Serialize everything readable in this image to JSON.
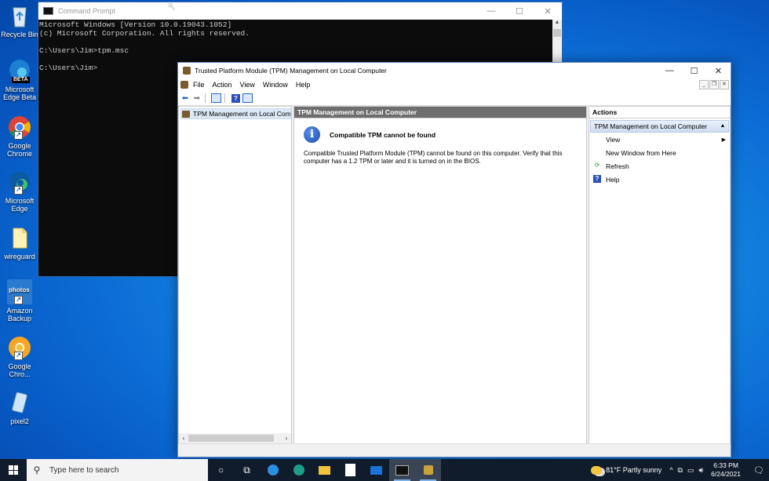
{
  "desktop": {
    "icons": [
      {
        "label": "Recycle Bin",
        "icon": "recycle-bin-icon"
      },
      {
        "label": "Microsoft Edge Beta",
        "badge": "BETA",
        "icon": "edge-beta-icon"
      },
      {
        "label": "Google Chrome",
        "icon": "chrome-icon"
      },
      {
        "label": "Microsoft Edge",
        "icon": "edge-icon"
      },
      {
        "label": "wireguard",
        "icon": "folder-icon"
      },
      {
        "label": "Amazon Backup",
        "badge": "photos",
        "icon": "amazon-photos-icon"
      },
      {
        "label": "Google Chro...",
        "icon": "chrome-canary-icon"
      },
      {
        "label": "pixel2",
        "icon": "pixel2-icon"
      }
    ]
  },
  "cmd": {
    "title": "Command Prompt",
    "lines": [
      "Microsoft Windows [Version 10.0.19043.1052]",
      "(c) Microsoft Corporation. All rights reserved.",
      "",
      "C:\\Users\\Jim>tpm.msc",
      "",
      "C:\\Users\\Jim>"
    ]
  },
  "tpm": {
    "title": "Trusted Platform Module (TPM) Management on Local Computer",
    "menu": [
      "File",
      "Action",
      "View",
      "Window",
      "Help"
    ],
    "tree_node": "TPM Management on Local Comp",
    "center_header": "TPM Management on Local Computer",
    "message_title": "Compatible TPM cannot be found",
    "message_body": "Compatible Trusted Platform Module (TPM) cannot be found on this computer. Verify that this computer has a 1.2 TPM or later and it is turned on in the BIOS.",
    "actions_header": "Actions",
    "actions_section": "TPM Management on Local Computer",
    "actions": [
      {
        "label": "View",
        "icon": "none",
        "submenu": true
      },
      {
        "label": "New Window from Here",
        "icon": "none",
        "submenu": false
      },
      {
        "label": "Refresh",
        "icon": "refresh-icon",
        "submenu": false
      },
      {
        "label": "Help",
        "icon": "help-icon",
        "submenu": false
      }
    ]
  },
  "taskbar": {
    "search_placeholder": "Type here to search",
    "weather": "81°F  Partly sunny",
    "time": "6:33 PM",
    "date": "6/24/2021"
  },
  "colors": {
    "accent": "#0b6ad1",
    "taskbar": "#101b2b",
    "pane_header": "#6e6e6e"
  }
}
